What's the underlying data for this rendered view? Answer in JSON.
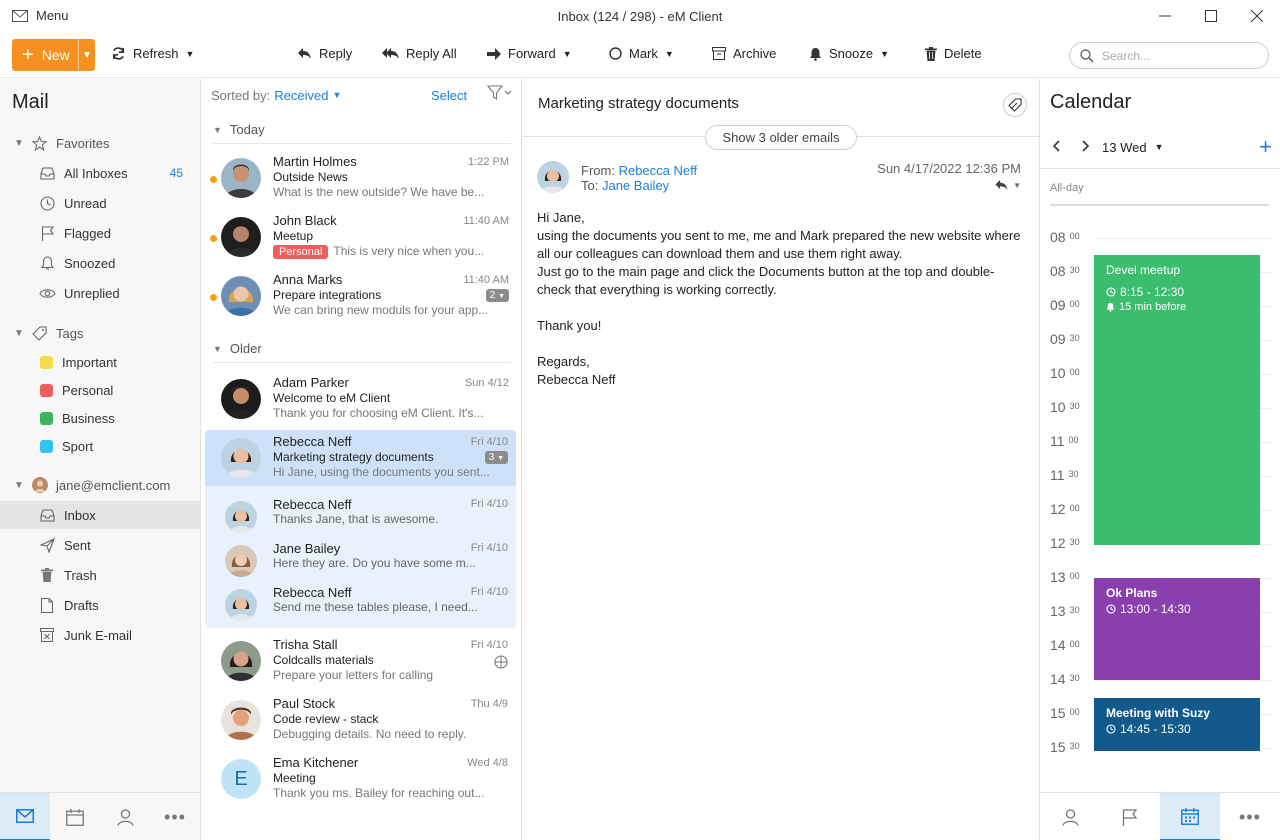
{
  "window": {
    "menu_label": "Menu",
    "title": "Inbox (124 / 298) - eM Client"
  },
  "toolbar": {
    "new_label": "New",
    "refresh_label": "Refresh",
    "reply_label": "Reply",
    "reply_all_label": "Reply All",
    "forward_label": "Forward",
    "mark_label": "Mark",
    "archive_label": "Archive",
    "snooze_label": "Snooze",
    "delete_label": "Delete",
    "search_placeholder": "Search..."
  },
  "sidebar": {
    "title": "Mail",
    "favorites": {
      "label": "Favorites",
      "items": [
        {
          "label": "All Inboxes",
          "count": "45",
          "icon": "inbox-icon"
        },
        {
          "label": "Unread",
          "icon": "clock-icon"
        },
        {
          "label": "Flagged",
          "icon": "flag-icon"
        },
        {
          "label": "Snoozed",
          "icon": "bell-icon"
        },
        {
          "label": "Unreplied",
          "icon": "eye-icon"
        }
      ]
    },
    "tags": {
      "label": "Tags",
      "items": [
        {
          "label": "Important",
          "color": "#f8d94a"
        },
        {
          "label": "Personal",
          "color": "#ef5d5d"
        },
        {
          "label": "Business",
          "color": "#3cb55e"
        },
        {
          "label": "Sport",
          "color": "#32c4ee"
        }
      ]
    },
    "account": {
      "label": "jane@emclient.com",
      "items": [
        {
          "label": "Inbox",
          "icon": "inbox-icon"
        },
        {
          "label": "Sent",
          "icon": "send-icon"
        },
        {
          "label": "Trash",
          "icon": "trash-icon"
        },
        {
          "label": "Drafts",
          "icon": "draft-icon"
        },
        {
          "label": "Junk E-mail",
          "icon": "junk-icon"
        }
      ]
    }
  },
  "list": {
    "sorted_by_label": "Sorted by:",
    "sorted_by_value": "Received",
    "select_label": "Select",
    "groups": {
      "today": "Today",
      "older": "Older"
    },
    "messages": [
      {
        "from": "Martin Holmes",
        "date": "1:22 PM",
        "subject": "Outside News",
        "preview": "What is the new outside? We have be..."
      },
      {
        "from": "John Black",
        "date": "11:40 AM",
        "subject": "Meetup",
        "tag": "Personal",
        "preview": "This is very nice when you..."
      },
      {
        "from": "Anna Marks",
        "date": "11:40 AM",
        "subject": "Prepare integrations",
        "count": "2",
        "preview": "We can bring new moduls for your app..."
      },
      {
        "from": "Adam Parker",
        "date": "Sun 4/12",
        "subject": "Welcome to eM Client",
        "preview": "Thank you for choosing eM Client. It's..."
      },
      {
        "from": "Rebecca Neff",
        "date": "Fri 4/10",
        "subject": "Marketing strategy documents",
        "count": "3",
        "preview": "Hi Jane, using the documents you sent..."
      },
      {
        "from": "Rebecca Neff",
        "date": "Fri 4/10",
        "preview": "Thanks Jane, that is awesome."
      },
      {
        "from": "Jane Bailey",
        "date": "Fri 4/10",
        "preview": "Here they are. Do you have some m..."
      },
      {
        "from": "Rebecca Neff",
        "date": "Fri 4/10",
        "preview": "Send me these tables please, I need..."
      },
      {
        "from": "Trisha Stall",
        "date": "Fri 4/10",
        "subject": "Coldcalls materials",
        "preview": "Prepare your letters for calling"
      },
      {
        "from": "Paul Stock",
        "date": "Thu 4/9",
        "subject": "Code review - stack",
        "preview": "Debugging details. No need to reply."
      },
      {
        "from": "Ema Kitchener",
        "date": "Wed 4/8",
        "subject": "Meeting",
        "preview": "Thank you ms. Bailey for reaching out...",
        "initial": "E"
      }
    ]
  },
  "reader": {
    "subject": "Marketing strategy documents",
    "older_button": "Show 3 older emails",
    "from_label": "From:",
    "from_name": "Rebecca Neff",
    "to_label": "To:",
    "to_name": "Jane Bailey",
    "date": "Sun 4/17/2022 12:36 PM",
    "body": {
      "greeting": "Hi Jane,",
      "line1": "using the documents you sent to me, me and Mark prepared the new website where",
      "line2": "all our colleagues can download them and use them right away.",
      "line3": "Just go to the main page and click the Documents button at the top and double-",
      "line4": "check that everything is working correctly.",
      "thanks": "Thank you!",
      "regards": "Regards,",
      "signature": "Rebecca Neff"
    }
  },
  "calendar": {
    "title": "Calendar",
    "date_label": "13 Wed",
    "allday_label": "All-day",
    "hours": [
      {
        "h": "08",
        "m": "00"
      },
      {
        "h": "08",
        "m": "30"
      },
      {
        "h": "09",
        "m": "00"
      },
      {
        "h": "09",
        "m": "30"
      },
      {
        "h": "10",
        "m": "00"
      },
      {
        "h": "10",
        "m": "30"
      },
      {
        "h": "11",
        "m": "00"
      },
      {
        "h": "11",
        "m": "30"
      },
      {
        "h": "12",
        "m": "00"
      },
      {
        "h": "12",
        "m": "30"
      },
      {
        "h": "13",
        "m": "00"
      },
      {
        "h": "13",
        "m": "30"
      },
      {
        "h": "14",
        "m": "00"
      },
      {
        "h": "14",
        "m": "30"
      },
      {
        "h": "15",
        "m": "00"
      },
      {
        "h": "15",
        "m": "30"
      }
    ],
    "events": [
      {
        "title": "Devel meetup",
        "time": "8:15 - 12:30",
        "reminder": "15 min before",
        "color": "#3cbd6e"
      },
      {
        "title": "Ok Plans",
        "time": "13:00 - 14:30",
        "color": "#8a3fae"
      },
      {
        "title": "Meeting with Suzy",
        "time": "14:45 - 15:30",
        "color": "#125a8c"
      }
    ]
  },
  "colors": {
    "accent": "#1a7fd8",
    "new_button": "#f6901e"
  }
}
